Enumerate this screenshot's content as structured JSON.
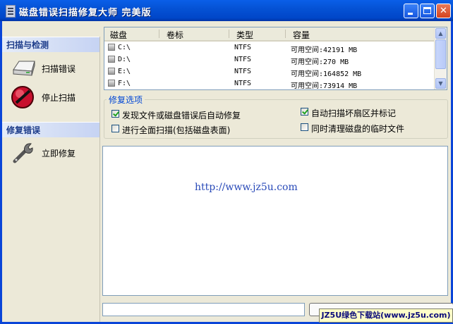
{
  "window": {
    "title": "磁盘错误扫描修复大师  完美版",
    "min_icon": "minimize-icon",
    "max_icon": "maximize-icon",
    "close_icon": "close-icon",
    "close_glyph": "✕"
  },
  "sidebar": {
    "sections": [
      {
        "title": "扫描与检测",
        "items": [
          {
            "label": "扫描错误",
            "icon": "disk-drive-icon"
          },
          {
            "label": "停止扫描",
            "icon": "stop-icon"
          }
        ]
      },
      {
        "title": "修复错误",
        "items": [
          {
            "label": "立即修复",
            "icon": "wrench-icon"
          }
        ]
      }
    ]
  },
  "disk_list": {
    "columns": [
      "磁盘",
      "卷标",
      "类型",
      "容量"
    ],
    "rows": [
      {
        "disk": "C:\\",
        "label": "",
        "type": "NTFS",
        "capacity": "可用空间:42191 MB"
      },
      {
        "disk": "D:\\",
        "label": "",
        "type": "NTFS",
        "capacity": "可用空间:270 MB"
      },
      {
        "disk": "E:\\",
        "label": "",
        "type": "NTFS",
        "capacity": "可用空间:164852 MB"
      },
      {
        "disk": "F:\\",
        "label": "",
        "type": "NTFS",
        "capacity": "可用空间:73914 MB"
      }
    ],
    "scroll_up": "▲",
    "scroll_down": "▼"
  },
  "options": {
    "legend": "修复选项",
    "items": [
      {
        "label": "发现文件或磁盘错误后自动修复",
        "checked": true
      },
      {
        "label": "自动扫描坏扇区并标记",
        "checked": true
      },
      {
        "label": "进行全面扫描(包括磁盘表面)",
        "checked": false
      },
      {
        "label": "同时清理磁盘的临时文件",
        "checked": false
      }
    ]
  },
  "log": {
    "text": "http://www.jz5u.com"
  },
  "status": {
    "value": ""
  },
  "watermark": "JZ5U绿色下载站(www.jz5u.com)"
}
